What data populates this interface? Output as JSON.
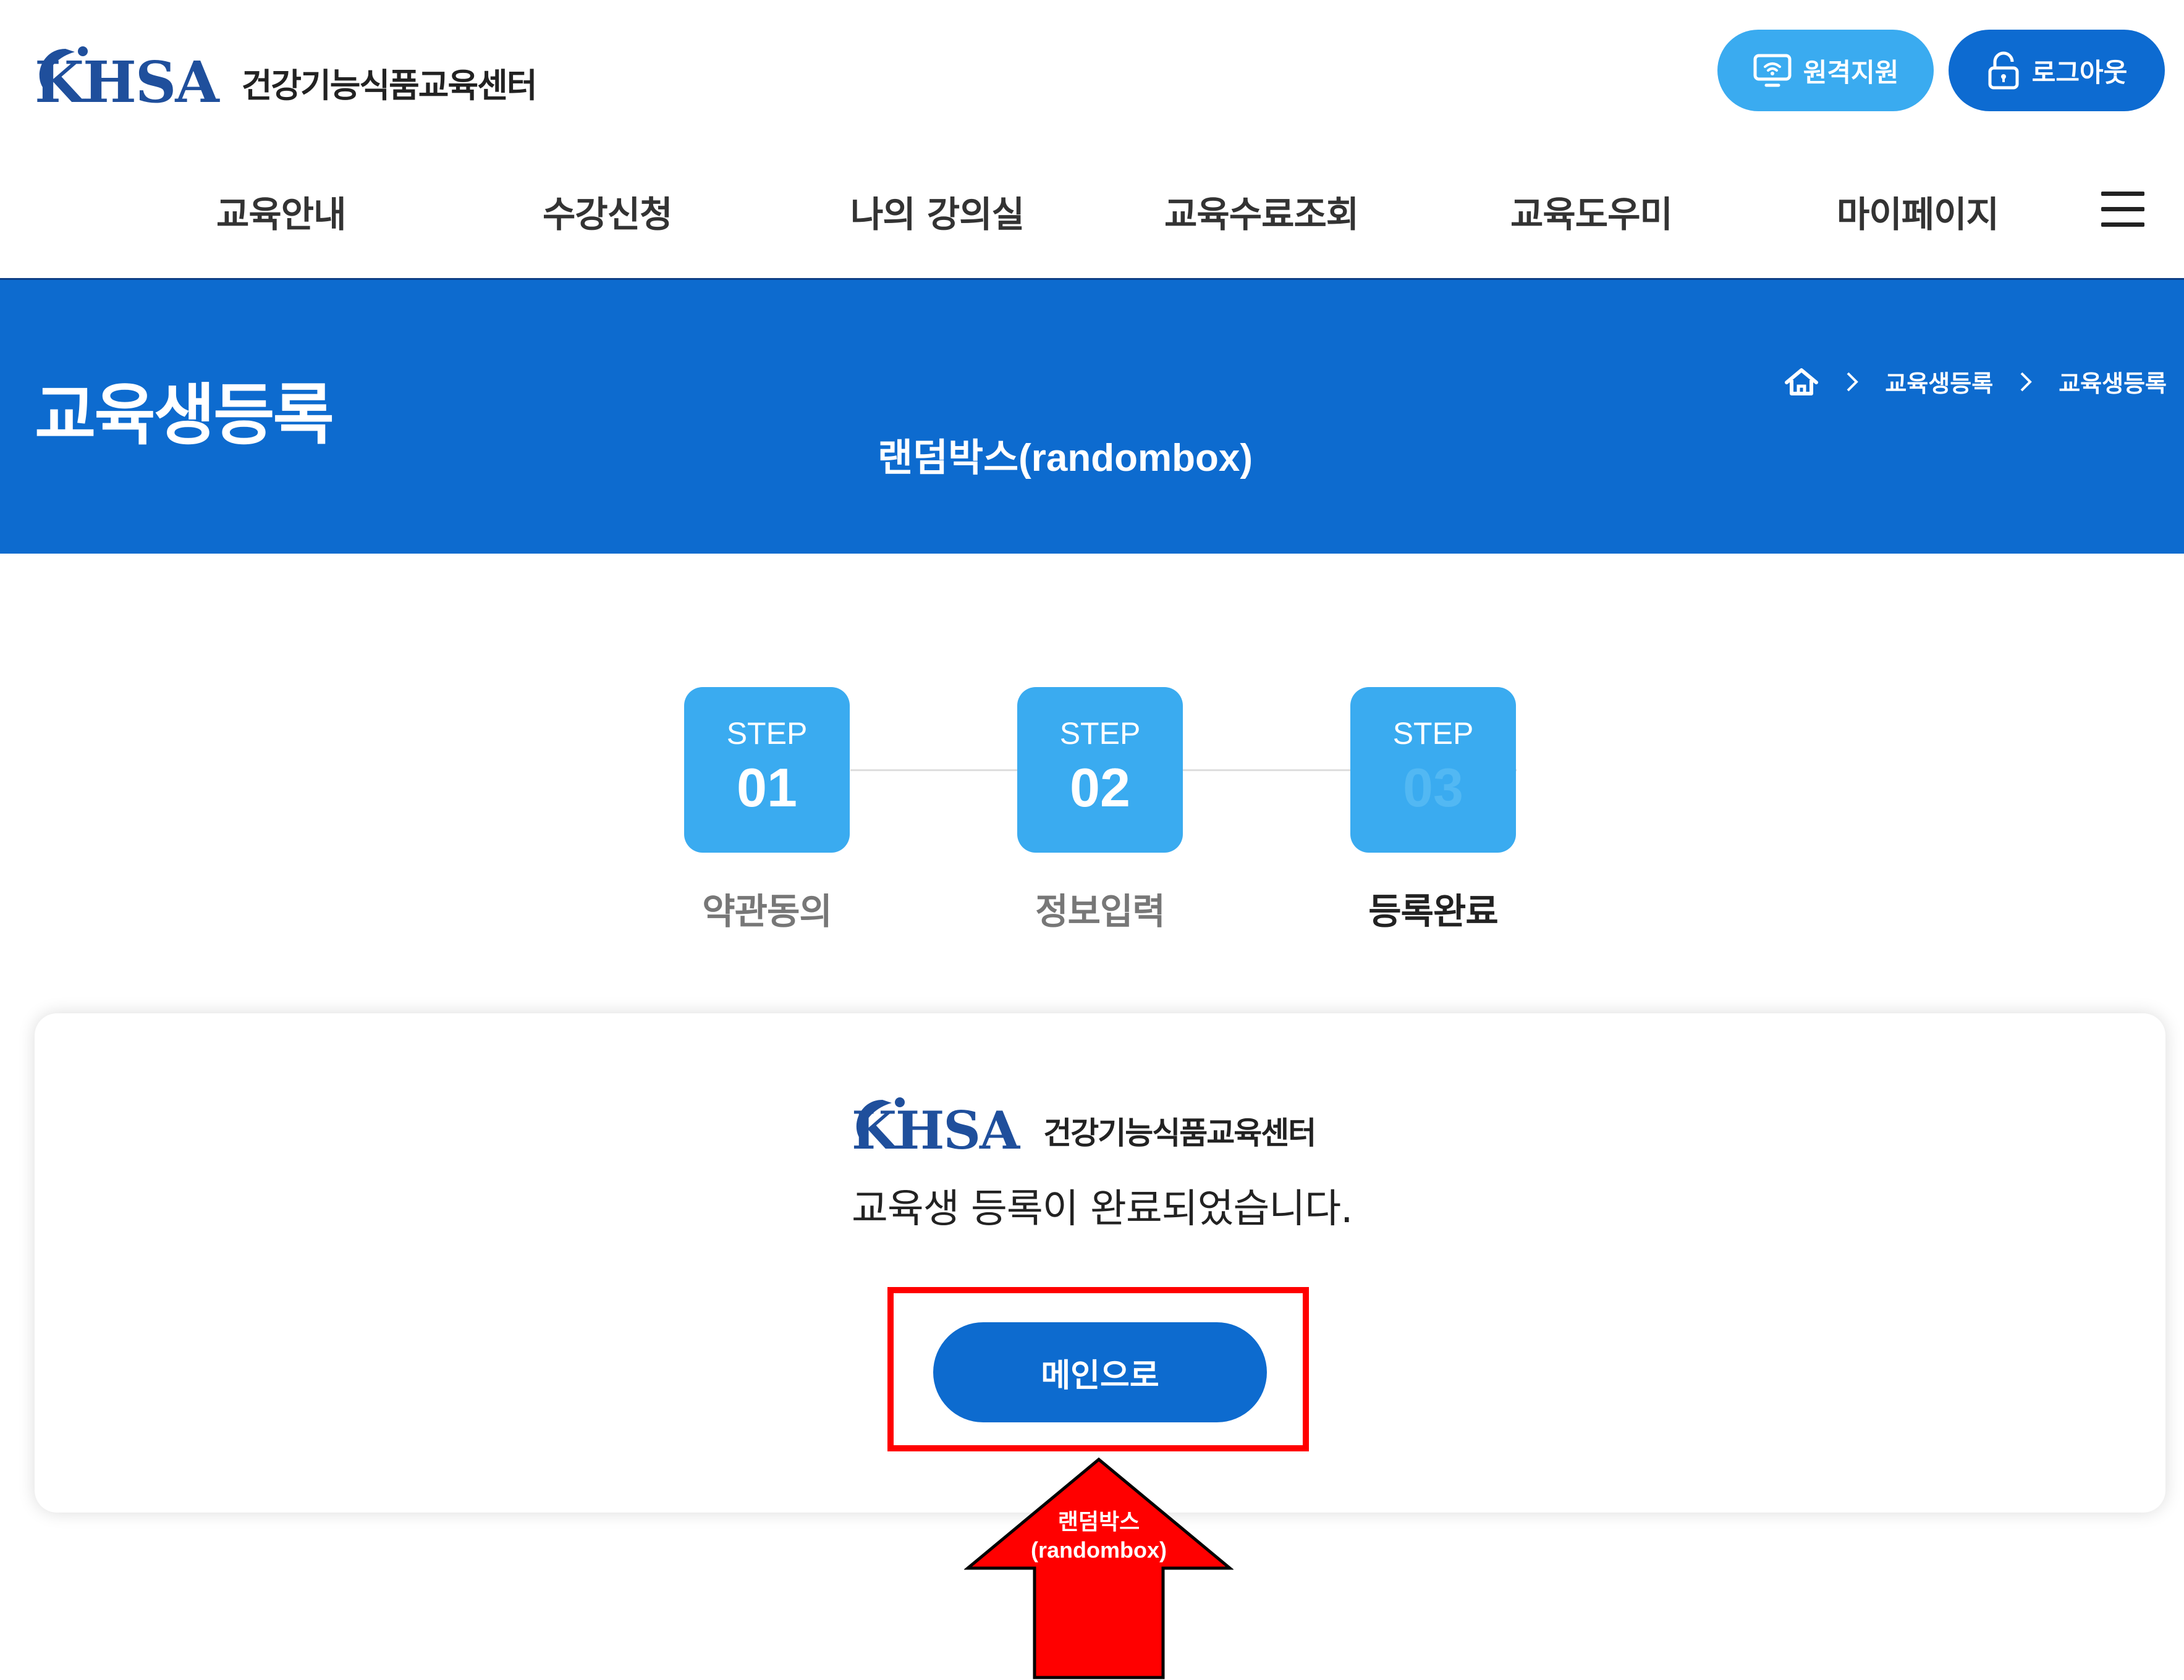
{
  "header": {
    "logo_mark": "KHSA",
    "logo_text": "건강기능식품교육센터",
    "remote_label": "원격지원",
    "logout_label": "로그아웃"
  },
  "nav": {
    "items": [
      {
        "label": "교육안내"
      },
      {
        "label": "수강신청"
      },
      {
        "label": "나의 강의실"
      },
      {
        "label": "교육수료조회"
      },
      {
        "label": "교육도우미"
      },
      {
        "label": "마이페이지"
      }
    ],
    "menu_icon": "hamburger-icon"
  },
  "banner": {
    "title": "교육생등록",
    "breadcrumb": [
      "교육생등록",
      "교육생등록"
    ],
    "home_icon": "home-icon"
  },
  "annotation": {
    "banner_label": "랜덤박스(randombox)",
    "arrow_label_line1": "랜덤박스",
    "arrow_label_line2": "(randombox)",
    "color": "#ff0000"
  },
  "steps": [
    {
      "word": "STEP",
      "num": "01",
      "label": "약관동의"
    },
    {
      "word": "STEP",
      "num": "02",
      "label": "정보입력"
    },
    {
      "word": "STEP",
      "num": "03",
      "label": "등록완료"
    }
  ],
  "card": {
    "logo_mark": "KHSA",
    "logo_text": "건강기능식품교육센터",
    "message": "교육생 등록이 완료되었습니다.",
    "main_button": "메인으로"
  },
  "colors": {
    "primary": "#0d6bcf",
    "accent": "#3aabf0",
    "logo_blue": "#1f4f9c"
  }
}
